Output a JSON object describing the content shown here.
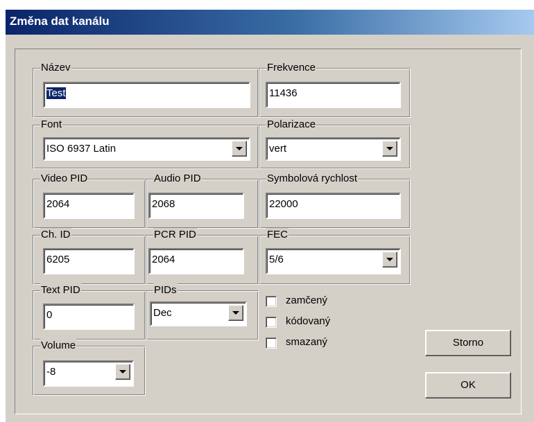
{
  "window": {
    "title": "Změna dat kanálu"
  },
  "groups": {
    "nazev": {
      "label": "Název",
      "value": "Test"
    },
    "frekvence": {
      "label": "Frekvence",
      "value": "11436"
    },
    "font": {
      "label": "Font",
      "value": "ISO 6937 Latin"
    },
    "polarizace": {
      "label": "Polarizace",
      "value": "vert"
    },
    "video_pid": {
      "label": "Video PID",
      "value": "2064"
    },
    "audio_pid": {
      "label": "Audio PID",
      "value": "2068"
    },
    "symbolova_rychlost": {
      "label": "Symbolová rychlost",
      "value": "22000"
    },
    "ch_id": {
      "label": "Ch. ID",
      "value": "6205"
    },
    "pcr_pid": {
      "label": "PCR PID",
      "value": "2064"
    },
    "fec": {
      "label": "FEC",
      "value": "5/6"
    },
    "text_pid": {
      "label": "Text PID",
      "value": "0"
    },
    "pids": {
      "label": "PIDs",
      "value": "Dec"
    },
    "volume": {
      "label": "Volume",
      "value": "-8"
    }
  },
  "checkboxes": {
    "zamceny": {
      "label": "zamčený",
      "checked": false
    },
    "kodovany": {
      "label": "kódovaný",
      "checked": false
    },
    "smazany": {
      "label": "smazaný",
      "checked": false
    }
  },
  "buttons": {
    "cancel": "Storno",
    "ok": "OK"
  },
  "colors": {
    "face": "#d4d0c8",
    "title_start": "#0a246a",
    "title_end": "#a6caf0",
    "selection": "#0a246a"
  }
}
